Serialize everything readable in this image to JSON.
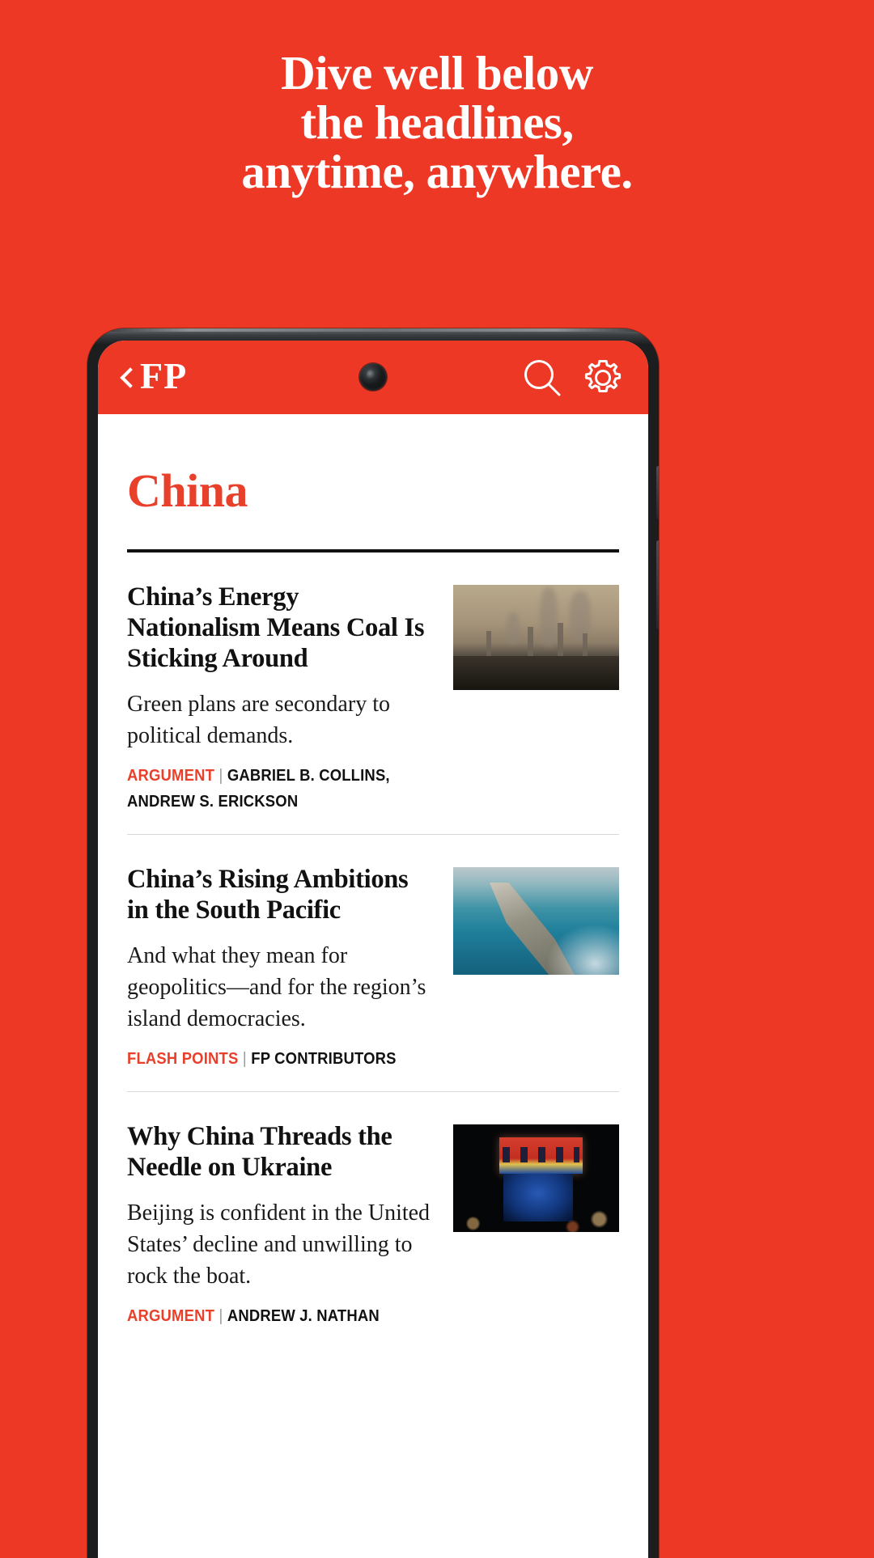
{
  "promo": {
    "lines": [
      "Dive well below",
      "the headlines,",
      "anytime, anywhere."
    ]
  },
  "colors": {
    "brand_red": "#EE3826",
    "accent_red": "#E8402A",
    "text_black": "#111111",
    "screen_white": "#FFFFFF"
  },
  "app": {
    "header": {
      "back_icon": "chevron-left-icon",
      "logo": "FP",
      "search_icon": "search-icon",
      "settings_icon": "gear-icon"
    },
    "section_title": "China",
    "articles": [
      {
        "title": "China’s Energy Nationalism Means Coal Is Sticking Around",
        "dek": "Green plans are secondary to political demands.",
        "category": "ARGUMENT",
        "separator": "|",
        "authors": "GABRIEL B. COLLINS, ANDREW S. ERICKSON",
        "thumbnail": "coal-power-plant-smokestacks"
      },
      {
        "title": "China’s Rising Ambitions in the South Pacific",
        "dek": "And what they mean for geopolitics—and for the region’s island democracies.",
        "category": "FLASH POINTS",
        "separator": "|",
        "authors": "FP CONTRIBUTORS",
        "thumbnail": "aerial-causeway-turquoise-sea"
      },
      {
        "title": "Why China Threads the Needle on Ukraine",
        "dek": "Beijing is confident in the United States’ decline and unwilling to rock the boat.",
        "category": "ARGUMENT",
        "separator": "|",
        "authors": "ANDREW J. NATHAN",
        "thumbnail": "night-city-big-screen-broadcast"
      }
    ]
  }
}
